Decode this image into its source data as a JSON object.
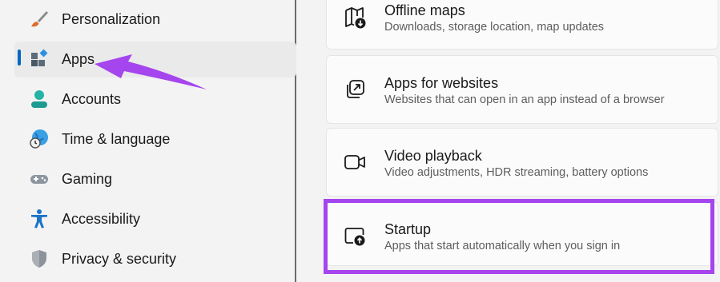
{
  "sidebar": {
    "items": [
      {
        "label": "Personalization",
        "icon": "paintbrush-icon"
      },
      {
        "label": "Apps",
        "icon": "apps-icon",
        "selected": true
      },
      {
        "label": "Accounts",
        "icon": "person-icon"
      },
      {
        "label": "Time & language",
        "icon": "globe-clock-icon"
      },
      {
        "label": "Gaming",
        "icon": "gamepad-icon"
      },
      {
        "label": "Accessibility",
        "icon": "accessibility-icon"
      },
      {
        "label": "Privacy & security",
        "icon": "shield-icon"
      }
    ]
  },
  "settings": {
    "cards": [
      {
        "title": "Offline maps",
        "subtitle": "Downloads, storage location, map updates",
        "icon": "offline-map-icon"
      },
      {
        "title": "Apps for websites",
        "subtitle": "Websites that can open in an app instead of a browser",
        "icon": "open-in-app-icon"
      },
      {
        "title": "Video playback",
        "subtitle": "Video adjustments, HDR streaming, battery options",
        "icon": "video-camera-icon"
      },
      {
        "title": "Startup",
        "subtitle": "Apps that start automatically when you sign in",
        "icon": "startup-icon"
      }
    ]
  },
  "colors": {
    "accent": "#0067c0",
    "annotation": "#a545ee"
  }
}
